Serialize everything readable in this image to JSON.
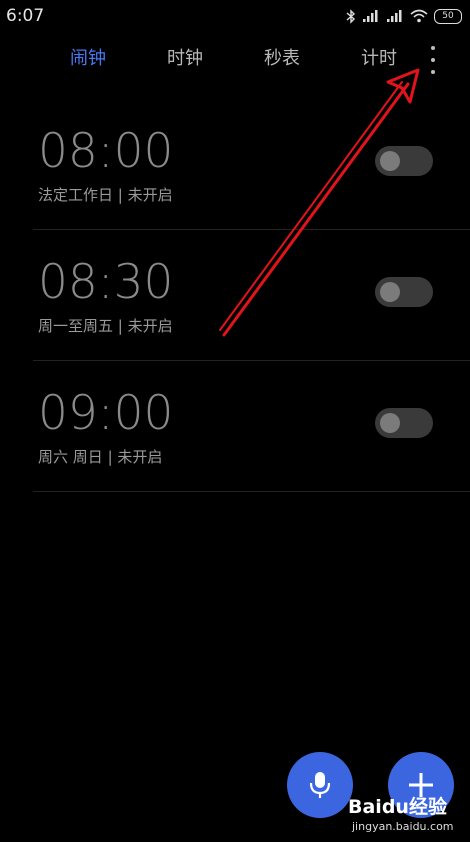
{
  "status_bar": {
    "time": "6:07",
    "battery": "50"
  },
  "tabs": [
    {
      "label": "闹钟",
      "active": true
    },
    {
      "label": "时钟",
      "active": false
    },
    {
      "label": "秒表",
      "active": false
    },
    {
      "label": "计时",
      "active": false
    }
  ],
  "alarms": [
    {
      "time": "08:00",
      "repeat": "法定工作日",
      "status": "未开启",
      "enabled": false
    },
    {
      "time": "08:30",
      "repeat": "周一至周五",
      "status": "未开启",
      "enabled": false
    },
    {
      "time": "09:00",
      "repeat": "周六 周日",
      "status": "未开启",
      "enabled": false
    }
  ],
  "colors": {
    "accent": "#4a78f2",
    "fab": "#3c66e0",
    "annotation": "#e0141a"
  },
  "watermark": {
    "title": "Baidu经验",
    "url": "jingyan.baidu.com"
  }
}
